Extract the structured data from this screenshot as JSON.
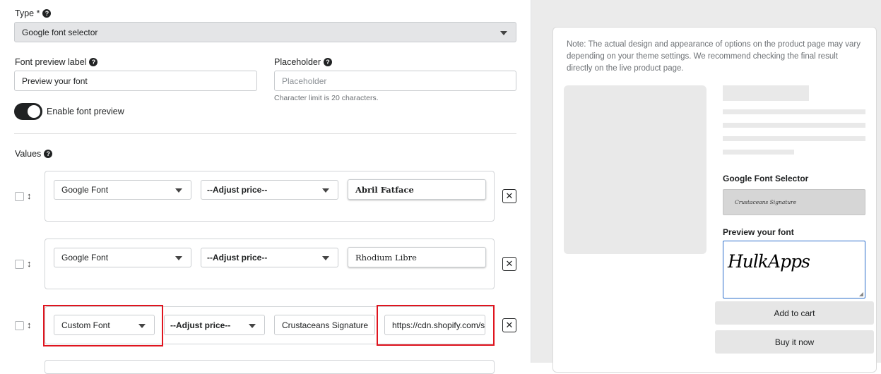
{
  "form": {
    "type_label": "Type *",
    "type_value": "Google font selector",
    "font_preview_label_label": "Font preview label",
    "font_preview_label_value": "Preview your font",
    "placeholder_label": "Placeholder",
    "placeholder_placeholder": "Placeholder",
    "char_limit_hint": "Character limit is 20 characters.",
    "enable_preview_label": "Enable font preview",
    "values_label": "Values"
  },
  "values": [
    {
      "font_type": "Google Font",
      "adjust_price": "--Adjust price--",
      "font_name": "Abril Fatface"
    },
    {
      "font_type": "Google Font",
      "adjust_price": "--Adjust price--",
      "font_name": "Rhodium Libre"
    },
    {
      "font_type": "Custom Font",
      "adjust_price": "--Adjust price--",
      "font_name": "Crustaceans Signature",
      "font_url": "https://cdn.shopify.com/s..."
    }
  ],
  "preview": {
    "note": "Note: The actual design and appearance of options on the product page may vary depending on your theme settings. We recommend checking the final result directly on the live product page.",
    "selector_title": "Google Font Selector",
    "selector_value": "Crustaceans Signature",
    "preview_title": "Preview your font",
    "preview_text": "HulkApps",
    "add_to_cart": "Add to cart",
    "buy_now": "Buy it now"
  },
  "colors": {
    "highlight": "#e0141e",
    "toggle_on": "#202223",
    "preview_border": "#2c6ecb"
  },
  "icons": [
    "help-icon",
    "caret-down-icon",
    "drag-handle-icon",
    "close-icon",
    "resize-handle-icon"
  ]
}
